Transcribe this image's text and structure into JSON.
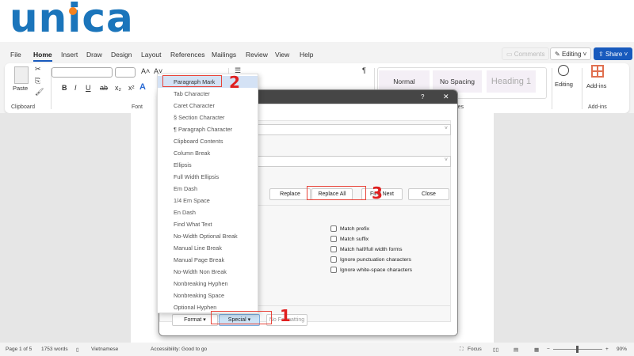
{
  "logo": {
    "text": "unica"
  },
  "menubar": {
    "items": [
      "File",
      "Home",
      "Insert",
      "Draw",
      "Design",
      "Layout",
      "References",
      "Mailings",
      "Review",
      "View",
      "Help"
    ],
    "active": "Home"
  },
  "topbar": {
    "comments": "Comments",
    "editing": "Editing",
    "share": "Share"
  },
  "ribbon": {
    "clipboard": {
      "paste": "Paste",
      "label": "Clipboard"
    },
    "font": {
      "label": "Font",
      "bold": "B",
      "italic": "I",
      "underline": "U",
      "strike": "ab",
      "sub": "x₂",
      "sup": "x²"
    },
    "styles": {
      "items": [
        "Normal",
        "No Spacing",
        "Heading 1"
      ],
      "label": "Styles"
    },
    "editing": {
      "label": "Editing"
    },
    "addins": {
      "label": "Add-ins",
      "group": "Add-ins"
    }
  },
  "dialog": {
    "help": "?",
    "close": "✕",
    "buttons": {
      "replace": "Replace",
      "replace_all": "Replace All",
      "find_next": "Find Next",
      "close": "Close"
    },
    "options": [
      "Match prefix",
      "Match suffix",
      "Match half/full width forms",
      "Ignore punctuation characters",
      "Ignore white-space characters"
    ],
    "bottom": {
      "format": "Format ▾",
      "special": "Special ▾",
      "no_formatting": "No Formatting"
    }
  },
  "special_menu": {
    "items": [
      "Paragraph Mark",
      "Tab Character",
      "Caret Character",
      "§ Section Character",
      "¶ Paragraph Character",
      "Clipboard Contents",
      "Column Break",
      "Ellipsis",
      "Full Width Ellipsis",
      "Em Dash",
      "1/4 Em Space",
      "En Dash",
      "Find What Text",
      "No-Width Optional Break",
      "Manual Line Break",
      "Manual Page Break",
      "No-Width Non Break",
      "Nonbreaking Hyphen",
      "Nonbreaking Space",
      "Optional Hyphen"
    ],
    "highlighted": "Paragraph Mark"
  },
  "annotations": [
    "1",
    "2",
    "3"
  ],
  "status": {
    "page": "Page 1 of 5",
    "words": "1753 words",
    "language": "Vietnamese",
    "accessibility": "Accessibility: Good to go",
    "focus": "Focus",
    "zoom": "90%"
  },
  "colors": {
    "accent": "#185abd",
    "annotation": "#e01f1f",
    "logo_blue": "#1b75bb",
    "logo_orange": "#f5821f"
  }
}
